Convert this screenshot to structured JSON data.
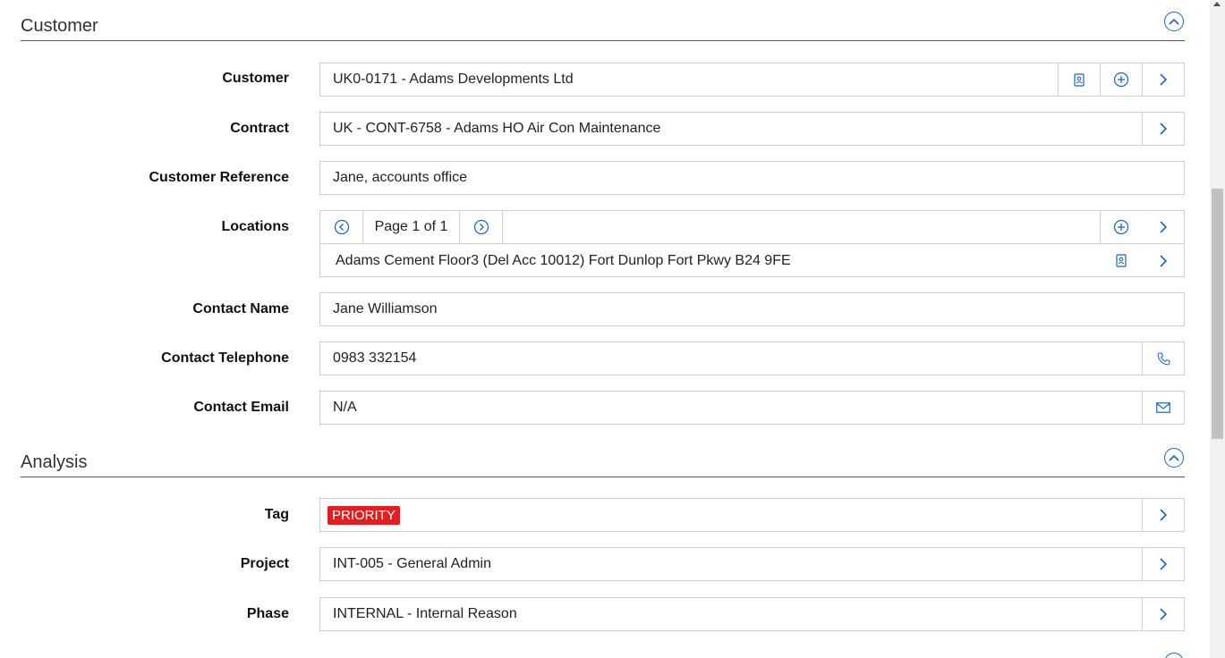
{
  "sections": {
    "customer": {
      "title": "Customer"
    },
    "analysis": {
      "title": "Analysis"
    }
  },
  "fields": {
    "customer": {
      "label": "Customer",
      "value": "UK0-0171 - Adams Developments Ltd"
    },
    "contract": {
      "label": "Contract",
      "value": "UK - CONT-6758 - Adams HO Air Con Maintenance"
    },
    "customer_reference": {
      "label": "Customer Reference",
      "value": "Jane, accounts office"
    },
    "locations": {
      "label": "Locations",
      "pager": "Page 1 of 1",
      "item": "Adams Cement Floor3 (Del Acc 10012) Fort Dunlop Fort Pkwy B24 9FE"
    },
    "contact_name": {
      "label": "Contact Name",
      "value": "Jane Williamson"
    },
    "contact_telephone": {
      "label": "Contact Telephone",
      "value": "0983 332154"
    },
    "contact_email": {
      "label": "Contact Email",
      "value": "N/A"
    },
    "tag": {
      "label": "Tag",
      "value": "PRIORITY"
    },
    "project": {
      "label": "Project",
      "value": "INT-005 - General Admin"
    },
    "phase": {
      "label": "Phase",
      "value": "INTERNAL - Internal Reason"
    }
  },
  "icons": {
    "accent": "#1f63b8",
    "tag_color": "#e02020",
    "collapse": "chevron-up-circle-icon",
    "contact_card": "contact-card-icon",
    "add": "plus-circle-icon",
    "navigate": "chevron-right-icon",
    "prev": "chevron-left-circle-icon",
    "next": "chevron-right-circle-icon",
    "phone": "phone-icon",
    "email": "envelope-icon"
  }
}
